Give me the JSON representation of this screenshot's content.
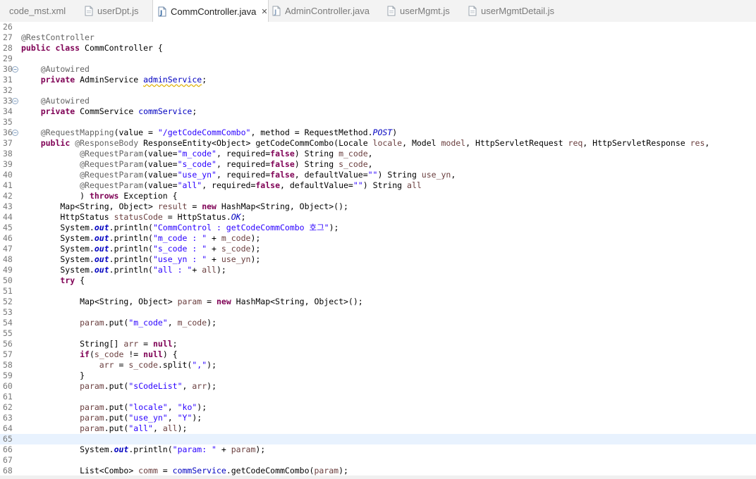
{
  "tabs": [
    {
      "label": "code_mst.xml",
      "icon": "xml-file-icon",
      "active": false
    },
    {
      "label": "userDpt.js",
      "icon": "js-file-icon",
      "active": false
    },
    {
      "label": "CommController.java",
      "icon": "java-file-icon",
      "active": true,
      "close": "✕"
    },
    {
      "label": "AdminController.java",
      "icon": "java-file-icon",
      "active": false
    },
    {
      "label": "userMgmt.js",
      "icon": "js-file-icon",
      "active": false
    },
    {
      "label": "userMgmtDetail.js",
      "icon": "js-file-icon",
      "active": false
    }
  ],
  "editor": {
    "current_line": 65,
    "lines": [
      {
        "n": "26",
        "t": [
          {
            "s": ""
          }
        ]
      },
      {
        "n": "27",
        "t": [
          {
            "s": "@RestController",
            "c": "an"
          }
        ]
      },
      {
        "n": "28",
        "t": [
          {
            "s": "public class",
            "c": "kw"
          },
          {
            "s": " CommController {"
          }
        ]
      },
      {
        "n": "29",
        "t": [
          {
            "s": ""
          }
        ]
      },
      {
        "n": "30",
        "fold": true,
        "t": [
          {
            "s": "    "
          },
          {
            "s": "@Autowired",
            "c": "an"
          }
        ]
      },
      {
        "n": "31",
        "t": [
          {
            "s": "    "
          },
          {
            "s": "private",
            "c": "kw"
          },
          {
            "s": " AdminService "
          },
          {
            "s": "adminService",
            "c": "fd warn"
          },
          {
            "s": ";"
          }
        ]
      },
      {
        "n": "32",
        "t": [
          {
            "s": ""
          }
        ]
      },
      {
        "n": "33",
        "fold": true,
        "t": [
          {
            "s": "    "
          },
          {
            "s": "@Autowired",
            "c": "an"
          }
        ]
      },
      {
        "n": "34",
        "t": [
          {
            "s": "    "
          },
          {
            "s": "private",
            "c": "kw"
          },
          {
            "s": " CommService "
          },
          {
            "s": "commService",
            "c": "fd"
          },
          {
            "s": ";"
          }
        ]
      },
      {
        "n": "35",
        "t": [
          {
            "s": ""
          }
        ]
      },
      {
        "n": "36",
        "fold": true,
        "t": [
          {
            "s": "    "
          },
          {
            "s": "@RequestMapping",
            "c": "an"
          },
          {
            "s": "(value = "
          },
          {
            "s": "\"/getCodeCommCombo\"",
            "c": "st"
          },
          {
            "s": ", method = RequestMethod."
          },
          {
            "s": "POST",
            "c": "sfs"
          },
          {
            "s": ")"
          }
        ]
      },
      {
        "n": "37",
        "t": [
          {
            "s": "    "
          },
          {
            "s": "public",
            "c": "kw"
          },
          {
            "s": " "
          },
          {
            "s": "@ResponseBody",
            "c": "an"
          },
          {
            "s": " ResponseEntity<Object> getCodeCommCombo(Locale "
          },
          {
            "s": "locale",
            "c": "pr"
          },
          {
            "s": ", Model "
          },
          {
            "s": "model",
            "c": "pr"
          },
          {
            "s": ", HttpServletRequest "
          },
          {
            "s": "req",
            "c": "pr"
          },
          {
            "s": ", HttpServletResponse "
          },
          {
            "s": "res",
            "c": "pr"
          },
          {
            "s": ","
          }
        ]
      },
      {
        "n": "38",
        "t": [
          {
            "s": "            "
          },
          {
            "s": "@RequestParam",
            "c": "an"
          },
          {
            "s": "(value="
          },
          {
            "s": "\"m_code\"",
            "c": "st"
          },
          {
            "s": ", required="
          },
          {
            "s": "false",
            "c": "kw"
          },
          {
            "s": ") String "
          },
          {
            "s": "m_code",
            "c": "pr"
          },
          {
            "s": ","
          }
        ]
      },
      {
        "n": "39",
        "t": [
          {
            "s": "            "
          },
          {
            "s": "@RequestParam",
            "c": "an"
          },
          {
            "s": "(value="
          },
          {
            "s": "\"s_code\"",
            "c": "st"
          },
          {
            "s": ", required="
          },
          {
            "s": "false",
            "c": "kw"
          },
          {
            "s": ") String "
          },
          {
            "s": "s_code",
            "c": "pr"
          },
          {
            "s": ","
          }
        ]
      },
      {
        "n": "40",
        "t": [
          {
            "s": "            "
          },
          {
            "s": "@RequestParam",
            "c": "an"
          },
          {
            "s": "(value="
          },
          {
            "s": "\"use_yn\"",
            "c": "st"
          },
          {
            "s": ", required="
          },
          {
            "s": "false",
            "c": "kw"
          },
          {
            "s": ", defaultValue="
          },
          {
            "s": "\"\"",
            "c": "st"
          },
          {
            "s": ") String "
          },
          {
            "s": "use_yn",
            "c": "pr"
          },
          {
            "s": ","
          }
        ]
      },
      {
        "n": "41",
        "t": [
          {
            "s": "            "
          },
          {
            "s": "@RequestParam",
            "c": "an"
          },
          {
            "s": "(value="
          },
          {
            "s": "\"all\"",
            "c": "st"
          },
          {
            "s": ", required="
          },
          {
            "s": "false",
            "c": "kw"
          },
          {
            "s": ", defaultValue="
          },
          {
            "s": "\"\"",
            "c": "st"
          },
          {
            "s": ") String "
          },
          {
            "s": "all",
            "c": "pr"
          }
        ]
      },
      {
        "n": "42",
        "t": [
          {
            "s": "            ) "
          },
          {
            "s": "throws",
            "c": "kw"
          },
          {
            "s": " Exception {"
          }
        ]
      },
      {
        "n": "43",
        "t": [
          {
            "s": "        Map<String, Object> "
          },
          {
            "s": "result",
            "c": "pr"
          },
          {
            "s": " = "
          },
          {
            "s": "new",
            "c": "kw"
          },
          {
            "s": " HashMap<String, Object>();"
          }
        ]
      },
      {
        "n": "44",
        "t": [
          {
            "s": "        HttpStatus "
          },
          {
            "s": "statusCode",
            "c": "pr"
          },
          {
            "s": " = HttpStatus."
          },
          {
            "s": "OK",
            "c": "sfs"
          },
          {
            "s": ";"
          }
        ]
      },
      {
        "n": "45",
        "t": [
          {
            "s": "        System."
          },
          {
            "s": "out",
            "c": "sf"
          },
          {
            "s": ".println("
          },
          {
            "s": "\"CommControl : getCodeCommCombo 호그\"",
            "c": "st"
          },
          {
            "s": ");"
          }
        ]
      },
      {
        "n": "46",
        "t": [
          {
            "s": "        System."
          },
          {
            "s": "out",
            "c": "sf"
          },
          {
            "s": ".println("
          },
          {
            "s": "\"m_code : \"",
            "c": "st"
          },
          {
            "s": " + "
          },
          {
            "s": "m_code",
            "c": "pr"
          },
          {
            "s": ");"
          }
        ]
      },
      {
        "n": "47",
        "t": [
          {
            "s": "        System."
          },
          {
            "s": "out",
            "c": "sf"
          },
          {
            "s": ".println("
          },
          {
            "s": "\"s_code : \"",
            "c": "st"
          },
          {
            "s": " + "
          },
          {
            "s": "s_code",
            "c": "pr"
          },
          {
            "s": ");"
          }
        ]
      },
      {
        "n": "48",
        "t": [
          {
            "s": "        System."
          },
          {
            "s": "out",
            "c": "sf"
          },
          {
            "s": ".println("
          },
          {
            "s": "\"use_yn : \"",
            "c": "st"
          },
          {
            "s": " + "
          },
          {
            "s": "use_yn",
            "c": "pr"
          },
          {
            "s": ");"
          }
        ]
      },
      {
        "n": "49",
        "t": [
          {
            "s": "        System."
          },
          {
            "s": "out",
            "c": "sf"
          },
          {
            "s": ".println("
          },
          {
            "s": "\"all : \"",
            "c": "st"
          },
          {
            "s": "+ "
          },
          {
            "s": "all",
            "c": "pr"
          },
          {
            "s": ");"
          }
        ]
      },
      {
        "n": "50",
        "t": [
          {
            "s": "        "
          },
          {
            "s": "try",
            "c": "kw"
          },
          {
            "s": " {"
          }
        ]
      },
      {
        "n": "51",
        "t": [
          {
            "s": ""
          }
        ]
      },
      {
        "n": "52",
        "t": [
          {
            "s": "            Map<String, Object> "
          },
          {
            "s": "param",
            "c": "pr"
          },
          {
            "s": " = "
          },
          {
            "s": "new",
            "c": "kw"
          },
          {
            "s": " HashMap<String, Object>();"
          }
        ]
      },
      {
        "n": "53",
        "t": [
          {
            "s": ""
          }
        ]
      },
      {
        "n": "54",
        "t": [
          {
            "s": "            "
          },
          {
            "s": "param",
            "c": "pr"
          },
          {
            "s": ".put("
          },
          {
            "s": "\"m_code\"",
            "c": "st"
          },
          {
            "s": ", "
          },
          {
            "s": "m_code",
            "c": "pr"
          },
          {
            "s": ");"
          }
        ]
      },
      {
        "n": "55",
        "t": [
          {
            "s": ""
          }
        ]
      },
      {
        "n": "56",
        "t": [
          {
            "s": "            String[] "
          },
          {
            "s": "arr",
            "c": "pr"
          },
          {
            "s": " = "
          },
          {
            "s": "null",
            "c": "kw"
          },
          {
            "s": ";"
          }
        ]
      },
      {
        "n": "57",
        "t": [
          {
            "s": "            "
          },
          {
            "s": "if",
            "c": "kw"
          },
          {
            "s": "("
          },
          {
            "s": "s_code",
            "c": "pr"
          },
          {
            "s": " != "
          },
          {
            "s": "null",
            "c": "kw"
          },
          {
            "s": ") {"
          }
        ]
      },
      {
        "n": "58",
        "t": [
          {
            "s": "                "
          },
          {
            "s": "arr",
            "c": "pr"
          },
          {
            "s": " = "
          },
          {
            "s": "s_code",
            "c": "pr"
          },
          {
            "s": ".split("
          },
          {
            "s": "\",\"",
            "c": "st"
          },
          {
            "s": ");"
          }
        ]
      },
      {
        "n": "59",
        "t": [
          {
            "s": "            }"
          }
        ]
      },
      {
        "n": "60",
        "t": [
          {
            "s": "            "
          },
          {
            "s": "param",
            "c": "pr"
          },
          {
            "s": ".put("
          },
          {
            "s": "\"sCodeList\"",
            "c": "st"
          },
          {
            "s": ", "
          },
          {
            "s": "arr",
            "c": "pr"
          },
          {
            "s": ");"
          }
        ]
      },
      {
        "n": "61",
        "t": [
          {
            "s": ""
          }
        ]
      },
      {
        "n": "62",
        "t": [
          {
            "s": "            "
          },
          {
            "s": "param",
            "c": "pr"
          },
          {
            "s": ".put("
          },
          {
            "s": "\"locale\"",
            "c": "st"
          },
          {
            "s": ", "
          },
          {
            "s": "\"ko\"",
            "c": "st"
          },
          {
            "s": ");"
          }
        ]
      },
      {
        "n": "63",
        "t": [
          {
            "s": "            "
          },
          {
            "s": "param",
            "c": "pr"
          },
          {
            "s": ".put("
          },
          {
            "s": "\"use_yn\"",
            "c": "st"
          },
          {
            "s": ", "
          },
          {
            "s": "\"Y\"",
            "c": "st"
          },
          {
            "s": ");"
          }
        ]
      },
      {
        "n": "64",
        "t": [
          {
            "s": "            "
          },
          {
            "s": "param",
            "c": "pr"
          },
          {
            "s": ".put("
          },
          {
            "s": "\"all\"",
            "c": "st"
          },
          {
            "s": ", "
          },
          {
            "s": "all",
            "c": "pr"
          },
          {
            "s": ");"
          }
        ]
      },
      {
        "n": "65",
        "t": [
          {
            "s": ""
          }
        ]
      },
      {
        "n": "66",
        "t": [
          {
            "s": "            System."
          },
          {
            "s": "out",
            "c": "sf"
          },
          {
            "s": ".println("
          },
          {
            "s": "\"param: \"",
            "c": "st"
          },
          {
            "s": " + "
          },
          {
            "s": "param",
            "c": "pr"
          },
          {
            "s": ");"
          }
        ]
      },
      {
        "n": "67",
        "t": [
          {
            "s": ""
          }
        ]
      },
      {
        "n": "68",
        "t": [
          {
            "s": "            List<Combo> "
          },
          {
            "s": "comm",
            "c": "pr"
          },
          {
            "s": " = "
          },
          {
            "s": "commService",
            "c": "fd"
          },
          {
            "s": ".getCodeCommCombo("
          },
          {
            "s": "param",
            "c": "pr"
          },
          {
            "s": ");"
          }
        ]
      }
    ]
  }
}
